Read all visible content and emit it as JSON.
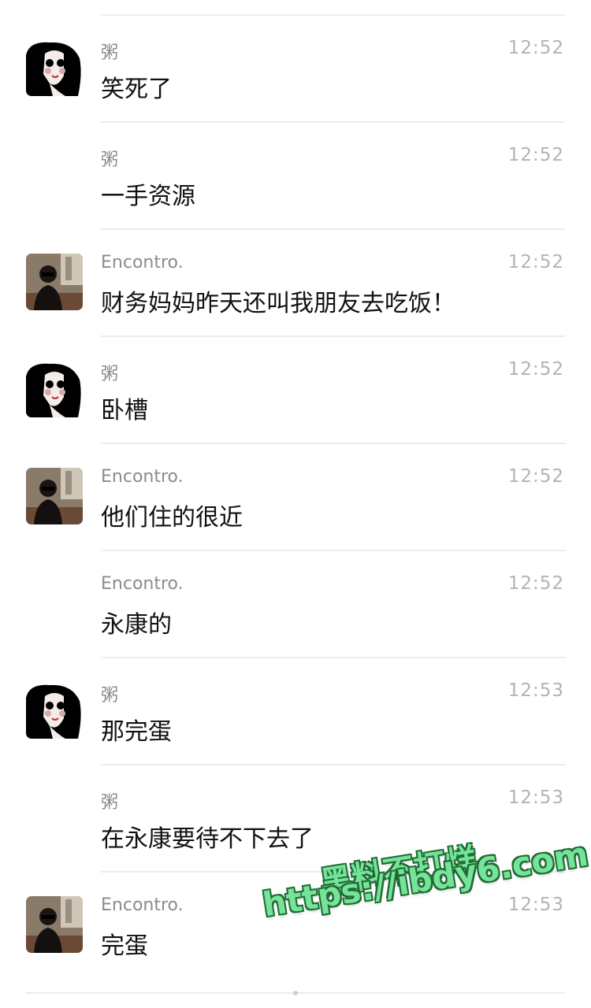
{
  "messages": [
    {
      "sender": "粥",
      "time": "12:52",
      "text": "笑死了",
      "avatar": "anime-girl-avatar"
    },
    {
      "sender": "粥",
      "time": "12:52",
      "text": "一手资源",
      "avatar": null
    },
    {
      "sender": "Encontro.",
      "time": "12:52",
      "text": "财务妈妈昨天还叫我朋友去吃饭！",
      "avatar": "woman-photo-avatar"
    },
    {
      "sender": "粥",
      "time": "12:52",
      "text": "卧槽",
      "avatar": "anime-girl-avatar"
    },
    {
      "sender": "Encontro.",
      "time": "12:52",
      "text": "他们住的很近",
      "avatar": "woman-photo-avatar"
    },
    {
      "sender": "Encontro.",
      "time": "12:52",
      "text": "永康的",
      "avatar": null
    },
    {
      "sender": "粥",
      "time": "12:53",
      "text": "那完蛋",
      "avatar": "anime-girl-avatar"
    },
    {
      "sender": "粥",
      "time": "12:53",
      "text": "在永康要待不下去了",
      "avatar": null
    },
    {
      "sender": "Encontro.",
      "time": "12:53",
      "text": "完蛋",
      "avatar": "woman-photo-avatar"
    }
  ],
  "watermark": {
    "line1": "黑料不打烊",
    "line2": "https://ibdy6.com"
  },
  "colors": {
    "sender": "#8b8b8b",
    "time": "#b3b3b3",
    "text": "#111111",
    "divider": "#ececec",
    "watermark_fill": "#76e39a",
    "watermark_stroke": "#1f6b33"
  }
}
